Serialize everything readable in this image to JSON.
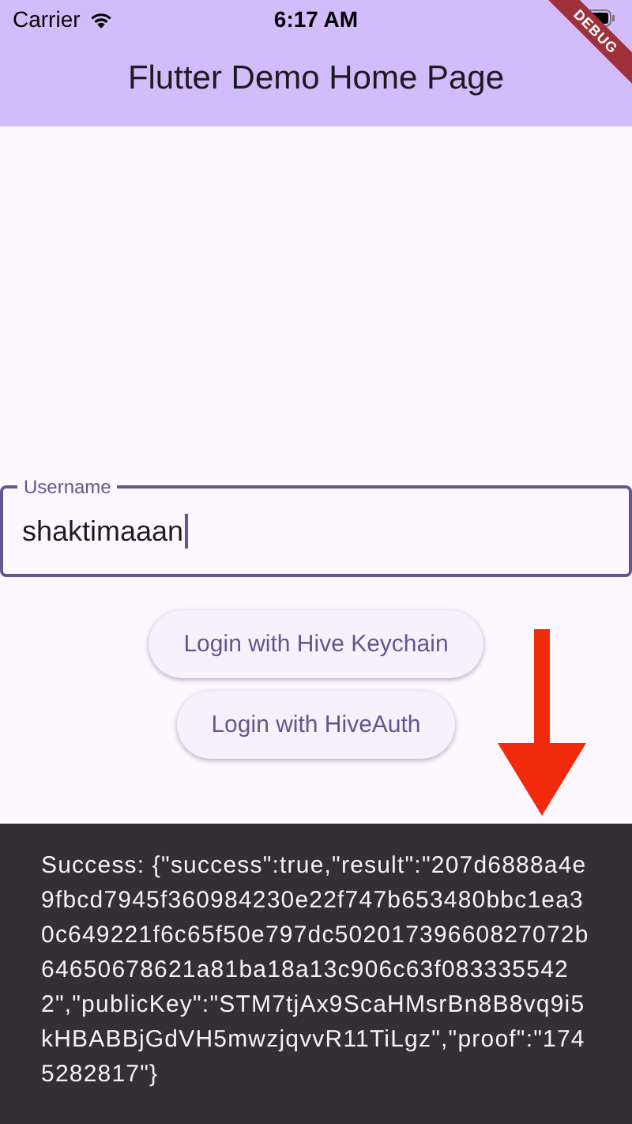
{
  "status_bar": {
    "carrier": "Carrier",
    "time": "6:17 AM"
  },
  "debug_banner": "DEBUG",
  "app_bar": {
    "title": "Flutter Demo Home Page"
  },
  "username_field": {
    "label": "Username",
    "value": "shaktimaaan",
    "focused": true
  },
  "buttons": [
    {
      "label": "Login with Hive Keychain"
    },
    {
      "label": "Login with HiveAuth"
    }
  ],
  "snackbar": {
    "message": "Success: {\"success\":true,\"result\":\"207d6888a4e9fbcd7945f360984230e22f747b653480bbc1ea30c649221f6c65f50e797dc50201739660827072b64650678621a81ba18a13c906c63f0833355422\",\"publicKey\":\"STM7tjAx9ScaHMsrBn8B8vq9i5kHBABBjGdVH5mwzjqvvR11TiLgz\",\"proof\":\"1745282817\"}"
  }
}
